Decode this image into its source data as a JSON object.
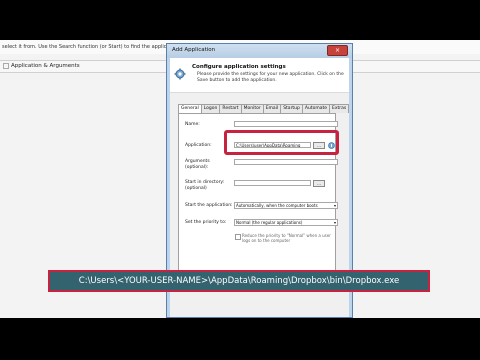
{
  "background": {
    "top_text": "select it from. Use the Search function (or Start) to find the application to ... ",
    "row_label": "Application & Arguments"
  },
  "dialog": {
    "title": "Add Application",
    "close_label": "×",
    "header_title": "Configure application settings",
    "header_desc": "Please provide the settings for your new application. Click on the Save button to add the application.",
    "tabs": [
      "General",
      "Logon",
      "Restart",
      "Monitor",
      "Email",
      "Startup",
      "Automate",
      "Extras"
    ],
    "active_tab": "General",
    "fields": {
      "name_label": "Name:",
      "name_value": "",
      "application_label": "Application:",
      "application_value": "C:\\Users\\user\\AppData\\Roaming",
      "arguments_label": "Arguments\n(optional):",
      "arguments_value": "",
      "start_dir_label": "Start in directory:\n(optional)",
      "start_dir_value": "",
      "start_app_label": "Start the application:",
      "start_app_value": "Automatically, when the computer boots",
      "priority_label": "Set the priority to:",
      "priority_value": "Normal (the regular applications)",
      "reduce_label": "Reduce the priority to \"Normal\" when a user logs on to the computer",
      "browse_label": "..."
    }
  },
  "banner": {
    "text": "C:\\Users\\<YOUR-USER-NAME>\\AppData\\Roaming\\Dropbox\\bin\\Dropbox.exe"
  },
  "colors": {
    "highlight": "#c7223f",
    "banner_bg": "#33636e",
    "dialog_frame": "#bcd4ec"
  }
}
